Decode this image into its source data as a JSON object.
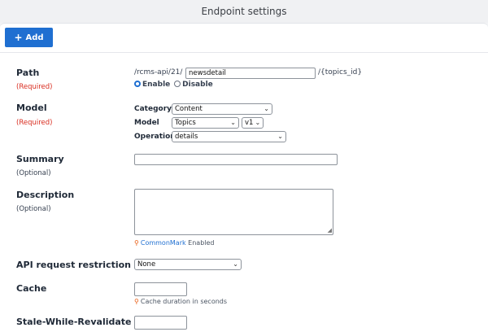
{
  "window": {
    "title": "Endpoint settings"
  },
  "toolbar": {
    "add_label": "Add"
  },
  "path": {
    "label": "Path",
    "required": "(Required)",
    "prefix": "/rcms-api/21/",
    "value": "newsdetail",
    "suffix": "/{topics_id}",
    "enable_label": "Enable",
    "disable_label": "Disable"
  },
  "model": {
    "label": "Model",
    "required": "(Required)",
    "category_label": "Category",
    "category_value": "Content",
    "model_label": "Model",
    "model_value": "Topics",
    "version_value": "v1",
    "operation_label": "Operation",
    "operation_value": "details"
  },
  "summary": {
    "label": "Summary",
    "optional": "(Optional)",
    "value": ""
  },
  "description": {
    "label": "Description",
    "optional": "(Optional)",
    "commonmark_link": "CommonMark",
    "commonmark_suffix": "Enabled"
  },
  "api_restriction": {
    "label": "API request restriction",
    "value": "None"
  },
  "cache": {
    "label": "Cache",
    "hint": "Cache duration in seconds",
    "value": ""
  },
  "swr": {
    "label": "Stale-While-Revalidate",
    "value": ""
  }
}
